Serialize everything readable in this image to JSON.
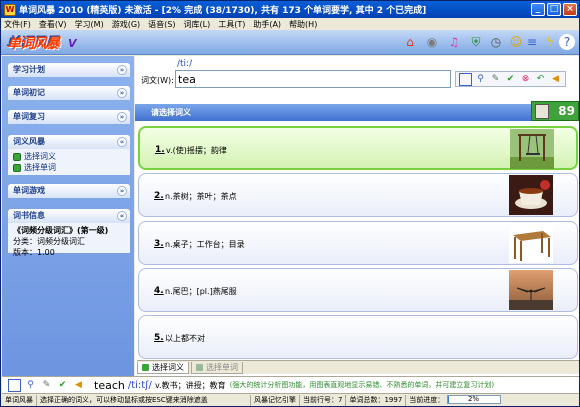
{
  "window": {
    "title": "单词风暴 2010 (精英版) 未激活 - [2% 完成 (38/1730), 共有 173 个单词要学, 其中 2 个已完成]",
    "minimize": "_",
    "maximize": "□",
    "close": "×"
  },
  "menu": [
    "文件(F)",
    "查看(V)",
    "学习(M)",
    "游戏(G)",
    "语音(S)",
    "词库(L)",
    "工具(T)",
    "助手(A)",
    "帮助(H)"
  ],
  "banner": {
    "logo": "单词风暴",
    "logo_mark": "V",
    "icons": [
      "home-icon",
      "cd-icon",
      "music-icon",
      "shield-icon",
      "timer-icon",
      "walker-icon",
      "notes-icon",
      "lightning-icon",
      "question-icon"
    ]
  },
  "sidebar": {
    "panels": [
      {
        "title": "学习计划",
        "chevron": "»"
      },
      {
        "title": "单词初记",
        "chevron": "»"
      },
      {
        "title": "单词复习",
        "chevron": "»"
      },
      {
        "title": "词义风暴",
        "chevron": "«",
        "links": [
          "选择词义",
          "选择单词"
        ]
      },
      {
        "title": "单词游戏",
        "chevron": "»"
      },
      {
        "title": "词书信息",
        "chevron": "«",
        "lines": [
          "《词频分级词汇》(第一级)",
          "分类：词频分级词汇",
          "版本：1.00"
        ]
      }
    ]
  },
  "main": {
    "phonetic": "/ti:/",
    "word_label": "词文(W):",
    "word_value": "tea",
    "choice_header": "请选择词义",
    "score": "89",
    "options": [
      {
        "num": "1.",
        "text": "v.(使)摇摆；韵律",
        "image": "swing-image"
      },
      {
        "num": "2.",
        "text": "n.茶树；茶叶；茶点",
        "image": "tea-image"
      },
      {
        "num": "3.",
        "text": "n.桌子；工作台；目录",
        "image": "table-image"
      },
      {
        "num": "4.",
        "text": "n.尾巴；[pl.]燕尾服",
        "image": "whale-tail-image"
      },
      {
        "num": "5.",
        "text": "以上都不对",
        "image": ""
      }
    ],
    "tabs": [
      "选择词义",
      "选择单词"
    ]
  },
  "bottom": {
    "word": "teach",
    "phonetic": "/ti:tʃ/",
    "definition": "v.教书；讲授；教育",
    "hint": "(强大的统计分析图功能，用图表直观地显示易错、不熟悉的单词，并可建立复习计划)"
  },
  "status": {
    "app": "单词风暴",
    "tip": "选择正确的词义，可以移动鼠标或按ESC键来消除遮盖",
    "engine": "风暴记忆引擎",
    "current_label": "当前行号：",
    "current_value": "7",
    "total_label": "单词总数：",
    "total_value": "1997",
    "progress_label": "当前进度：",
    "progress_value": "2%",
    "progress_fraction": 0.02
  }
}
